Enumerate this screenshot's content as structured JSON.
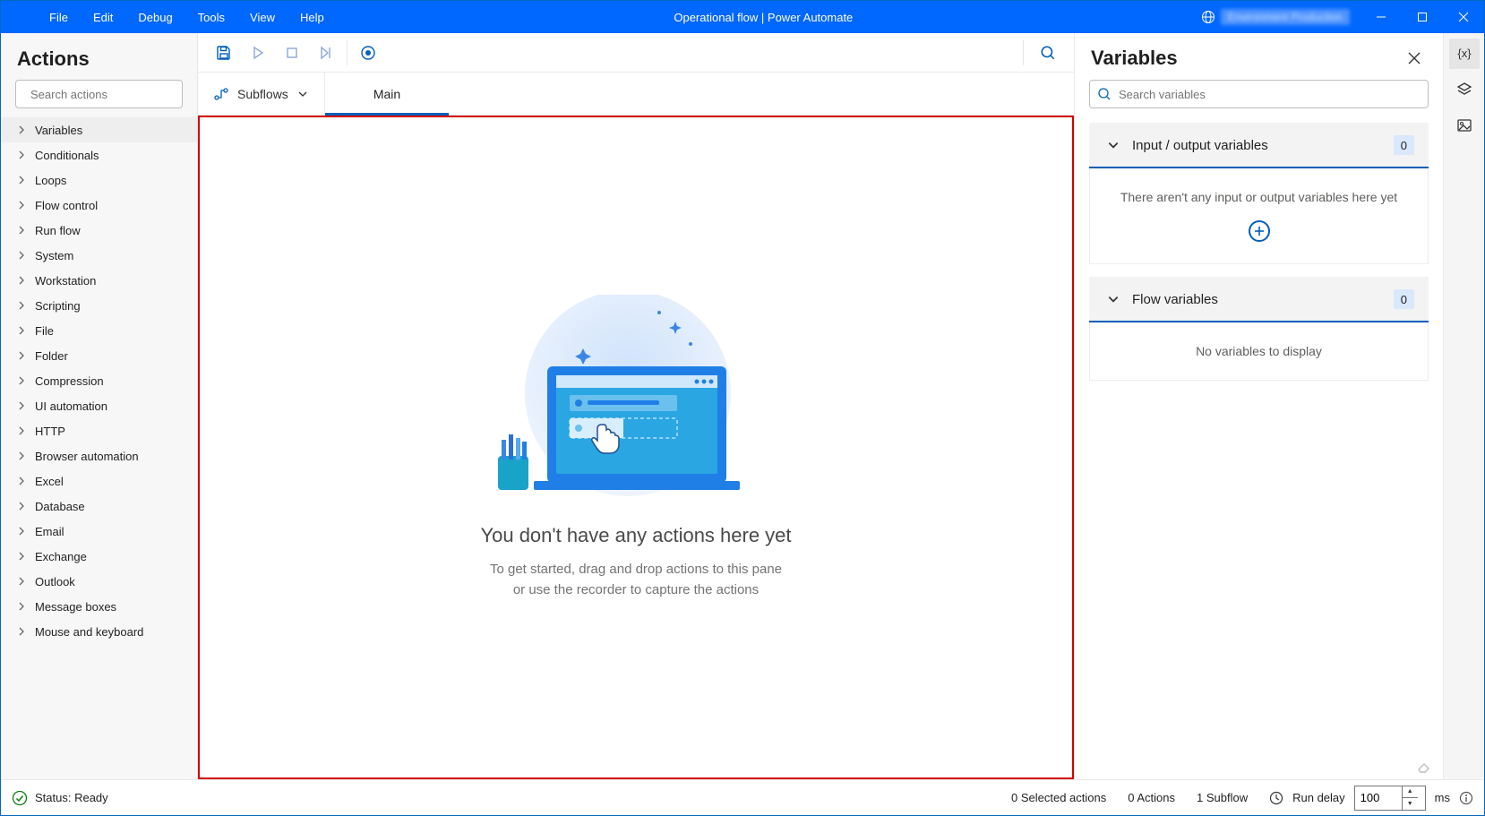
{
  "titlebar": {
    "menu": [
      "File",
      "Edit",
      "Debug",
      "Tools",
      "View",
      "Help"
    ],
    "title": "Operational flow | Power Automate"
  },
  "actions": {
    "heading": "Actions",
    "search_placeholder": "Search actions",
    "items": [
      "Variables",
      "Conditionals",
      "Loops",
      "Flow control",
      "Run flow",
      "System",
      "Workstation",
      "Scripting",
      "File",
      "Folder",
      "Compression",
      "UI automation",
      "HTTP",
      "Browser automation",
      "Excel",
      "Database",
      "Email",
      "Exchange",
      "Outlook",
      "Message boxes",
      "Mouse and keyboard"
    ],
    "selected_index": 0
  },
  "subflows": {
    "button_label": "Subflows",
    "tabs": [
      "Main"
    ],
    "active_tab": 0
  },
  "canvas_empty": {
    "title": "You don't have any actions here yet",
    "line1": "To get started, drag and drop actions to this pane",
    "line2": "or use the recorder to capture the actions"
  },
  "variables": {
    "heading": "Variables",
    "search_placeholder": "Search variables",
    "sections": [
      {
        "title": "Input / output variables",
        "count": "0",
        "empty_text": "There aren't any input or output variables here yet",
        "show_add": true
      },
      {
        "title": "Flow variables",
        "count": "0",
        "empty_text": "No variables to display",
        "show_add": false
      }
    ]
  },
  "statusbar": {
    "status": "Status: Ready",
    "selected": "0 Selected actions",
    "actions_count": "0 Actions",
    "subflows": "1 Subflow",
    "run_delay_label": "Run delay",
    "run_delay_value": "100",
    "run_delay_unit": "ms"
  }
}
